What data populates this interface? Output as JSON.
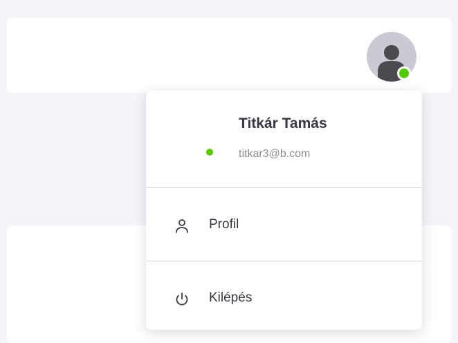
{
  "header": {
    "avatar_icon": "user-avatar-icon",
    "status_color": "#56ca00"
  },
  "user_menu": {
    "name": "Titkár Tamás",
    "email": "titkar3@b.com",
    "status_color": "#56ca00",
    "items": [
      {
        "label": "Profil",
        "icon": "user-icon"
      },
      {
        "label": "Kilépés",
        "icon": "power-icon"
      }
    ]
  },
  "colors": {
    "background": "#f4f5fa",
    "card": "#ffffff",
    "text_primary": "#3a3541",
    "text_secondary": "#8a8d93",
    "accent": "#8c7cf5"
  }
}
